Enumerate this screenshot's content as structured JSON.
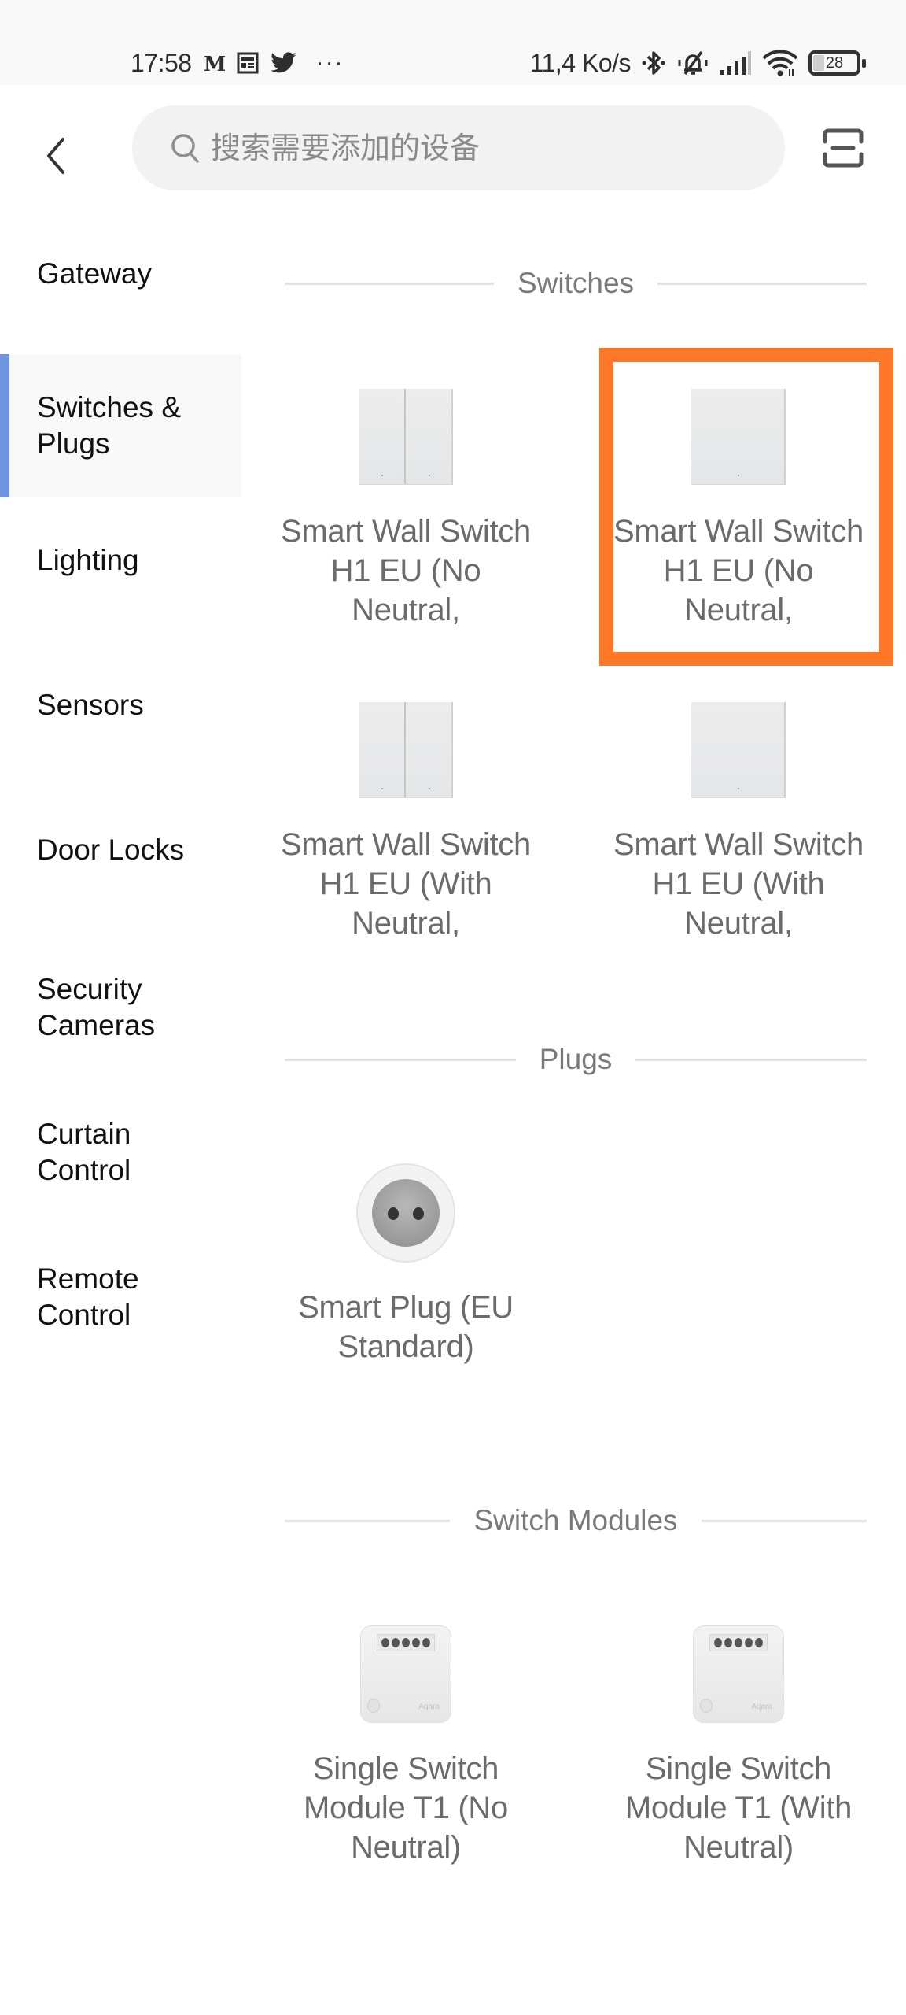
{
  "status_bar": {
    "time": "17:58",
    "left_icons": [
      "le-monde-icon",
      "news-icon",
      "twitter-icon",
      "more-notifications-icon"
    ],
    "more_glyph": "···",
    "network_speed": "11,4 Ko/s",
    "right_icons": [
      "bluetooth-icon",
      "silent-mode-icon",
      "signal-icon",
      "wifi-icon",
      "battery-icon"
    ],
    "battery_level": "28"
  },
  "header": {
    "search_placeholder": "搜索需要添加的设备",
    "back_icon": "chevron-left-icon",
    "scan_icon": "scan-icon"
  },
  "sidebar": {
    "selected_index": 1,
    "accent_color": "#6f95e0",
    "items": [
      {
        "label": "Gateway"
      },
      {
        "label": "Switches & Plugs"
      },
      {
        "label": "Lighting"
      },
      {
        "label": "Sensors"
      },
      {
        "label": "Door Locks"
      },
      {
        "label": "Security Cameras"
      },
      {
        "label": "Curtain Control"
      },
      {
        "label": "Remote Control"
      }
    ]
  },
  "sections": [
    {
      "title": "Switches",
      "devices": [
        {
          "name": "Smart Wall Switch H1 EU (No Neutral,",
          "image": "double-rocker-switch-icon"
        },
        {
          "name": "Smart Wall Switch H1 EU (No Neutral,",
          "image": "single-rocker-switch-icon",
          "highlighted": true
        },
        {
          "name": "Smart Wall Switch H1 EU (With Neutral,",
          "image": "double-rocker-switch-icon"
        },
        {
          "name": "Smart Wall Switch H1 EU (With Neutral,",
          "image": "single-rocker-switch-icon"
        }
      ]
    },
    {
      "title": "Plugs",
      "devices": [
        {
          "name": "Smart Plug (EU Standard)",
          "image": "eu-plug-icon"
        }
      ]
    },
    {
      "title": "Switch Modules",
      "devices": [
        {
          "name": "Single Switch Module T1 (No Neutral)",
          "image": "switch-module-icon",
          "brand": "Aqara"
        },
        {
          "name": "Single Switch Module T1 (With Neutral)",
          "image": "switch-module-icon",
          "brand": "Aqara"
        }
      ]
    }
  ],
  "highlight_color": "#ff7828"
}
